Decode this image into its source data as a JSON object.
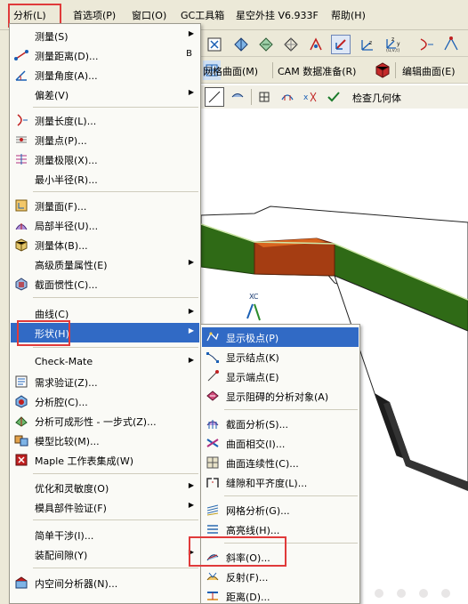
{
  "menubar": {
    "items": [
      "分析(L)",
      "首选项(P)",
      "窗口(O)",
      "GC工具箱",
      "星空外挂 V6.933F",
      "帮助(H)"
    ]
  },
  "toolbars": {
    "row2": {
      "mesh_surface": "网格曲面(M)",
      "cam_prep": "CAM 数据准备(R)",
      "edit_surface": "编辑曲面(E)"
    },
    "row3": {
      "check_geometry": "检查几何体"
    },
    "coord_label": "(u,v,t)"
  },
  "analysis_menu": {
    "items": [
      {
        "label": "测量(S)",
        "submenu": true
      },
      {
        "label": "测量距离(D)...",
        "shortcut": "B"
      },
      {
        "label": "测量角度(A)..."
      },
      {
        "label": "偏差(V)",
        "submenu": true
      },
      {
        "label": "测量长度(L)..."
      },
      {
        "label": "测量点(P)..."
      },
      {
        "label": "测量极限(X)..."
      },
      {
        "label": "最小半径(R)..."
      },
      {
        "label": "测量面(F)..."
      },
      {
        "label": "局部半径(U)..."
      },
      {
        "label": "测量体(B)..."
      },
      {
        "label": "高级质量属性(E)",
        "submenu": true
      },
      {
        "label": "截面惯性(C)..."
      },
      {
        "label": "曲线(C)",
        "submenu": true
      },
      {
        "label": "形状(H)",
        "submenu": true
      },
      {
        "label": "Check-Mate",
        "submenu": true
      },
      {
        "label": "需求验证(Z)..."
      },
      {
        "label": "分析腔(C)..."
      },
      {
        "label": "分析可成形性 - 一步式(Z)..."
      },
      {
        "label": "模型比较(M)..."
      },
      {
        "label": "Maple 工作表集成(W)"
      },
      {
        "label": "优化和灵敏度(O)",
        "submenu": true
      },
      {
        "label": "模具部件验证(F)",
        "submenu": true
      },
      {
        "label": "简单干涉(I)..."
      },
      {
        "label": "装配间隙(Y)",
        "submenu": true
      },
      {
        "label": "内空间分析器(N)..."
      }
    ]
  },
  "shape_submenu": {
    "items": [
      {
        "label": "显示极点(P)"
      },
      {
        "label": "显示结点(K)"
      },
      {
        "label": "显示端点(E)"
      },
      {
        "label": "显示阻碍的分析对象(A)"
      },
      {
        "label": "截面分析(S)..."
      },
      {
        "label": "曲面相交(I)..."
      },
      {
        "label": "曲面连续性(C)..."
      },
      {
        "label": "缝隙和平齐度(L)..."
      },
      {
        "label": "网格分析(G)..."
      },
      {
        "label": "高亮线(H)..."
      },
      {
        "label": "斜率(O)..."
      },
      {
        "label": "反射(F)..."
      },
      {
        "label": "距离(D)..."
      }
    ]
  },
  "colors": {
    "highlight": "#316ac5",
    "annotation": "#e03a3a",
    "model_green": "#3c7a1e",
    "model_orange": "#b24a14"
  }
}
